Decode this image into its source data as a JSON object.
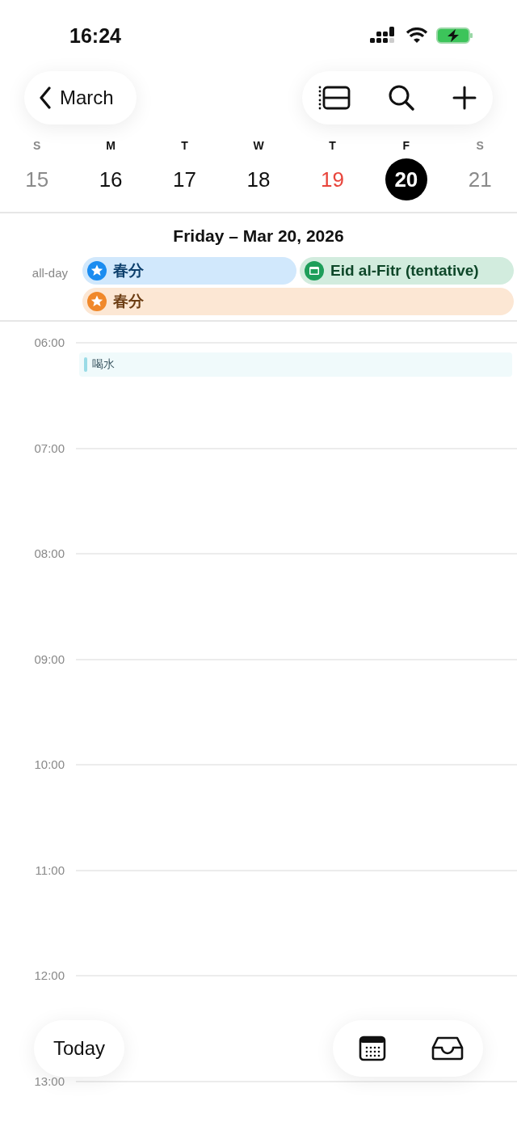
{
  "status_bar": {
    "time": "16:24"
  },
  "nav": {
    "back_label": "March"
  },
  "week": [
    {
      "letter": "S",
      "date": "15",
      "muted": true,
      "today": false,
      "selected": false
    },
    {
      "letter": "M",
      "date": "16",
      "muted": false,
      "today": false,
      "selected": false
    },
    {
      "letter": "T",
      "date": "17",
      "muted": false,
      "today": false,
      "selected": false
    },
    {
      "letter": "W",
      "date": "18",
      "muted": false,
      "today": false,
      "selected": false
    },
    {
      "letter": "T",
      "date": "19",
      "muted": false,
      "today": true,
      "selected": false
    },
    {
      "letter": "F",
      "date": "20",
      "muted": false,
      "today": false,
      "selected": true
    },
    {
      "letter": "S",
      "date": "21",
      "muted": true,
      "today": false,
      "selected": false
    }
  ],
  "day_title": "Friday – Mar 20, 2026",
  "all_day": {
    "label": "all-day",
    "rows": [
      [
        {
          "title": "春分",
          "kind": "star",
          "color": "#1a8cf0"
        },
        {
          "title": "Eid al-Fitr (tentative)",
          "kind": "calendar",
          "color": "#1e9e5a"
        }
      ],
      [
        {
          "title": "春分",
          "kind": "star",
          "color": "#f0882a"
        }
      ]
    ]
  },
  "hours": [
    {
      "label": "06:00",
      "events": [
        {
          "title": "喝水",
          "color": "#9adbe6"
        }
      ]
    },
    {
      "label": "07:00"
    },
    {
      "label": "08:00"
    },
    {
      "label": "09:00"
    },
    {
      "label": "10:00"
    },
    {
      "label": "11:00"
    },
    {
      "label": "12:00"
    },
    {
      "label": "13:00"
    }
  ],
  "bottom": {
    "today_label": "Today"
  }
}
